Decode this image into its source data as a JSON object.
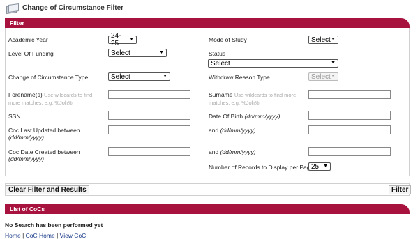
{
  "header": {
    "title": "Change of Circumstance Filter",
    "icon": "document-stack-icon"
  },
  "filter": {
    "bar_label": "Filter",
    "academic_year": {
      "label": "Academic Year",
      "value": "24-25"
    },
    "mode_of_study": {
      "label": "Mode of Study",
      "value": "Select"
    },
    "level_of_funding": {
      "label": "Level Of Funding",
      "value": "Select"
    },
    "status": {
      "label": "Status",
      "value": "Select"
    },
    "coc_type": {
      "label": "Change of Circumstance Type",
      "value": "Select"
    },
    "withdraw_reason": {
      "label": "Withdraw Reason Type",
      "value": "Select"
    },
    "forename": {
      "label": "Forename(s)",
      "hint": "Use wildcards to find more matches, e.g. %Joh%"
    },
    "surname": {
      "label": "Surname",
      "hint": "Use wildcards to find more matches, e.g. %Joh%"
    },
    "ssn": {
      "label": "SSN"
    },
    "dob": {
      "label": "Date Of Birth",
      "format": "(dd/mm/yyyy)"
    },
    "coc_last_updated": {
      "label": "Coc Last Updated between",
      "format": "(dd/mm/yyyy)",
      "and_label": "and",
      "and_format": "(dd/mm/yyyy)"
    },
    "coc_date_created": {
      "label": "Coc Date Created between",
      "format": "(dd/mm/yyyy)",
      "and_label": "and",
      "and_format": "(dd/mm/yyyy)"
    },
    "records_per_page": {
      "label": "Number of Records to Display per Page",
      "value": "25"
    }
  },
  "buttons": {
    "clear": "Clear Filter and Results",
    "filter": "Filter"
  },
  "list": {
    "bar_label": "List of CoCs",
    "empty_message": "No Search has been performed yet"
  },
  "footer_links": {
    "home": "Home",
    "sep1": "|",
    "coc_home": "CoC Home",
    "sep2": "|",
    "view_coc": "View CoC"
  },
  "colors": {
    "accent": "#a8123e"
  }
}
